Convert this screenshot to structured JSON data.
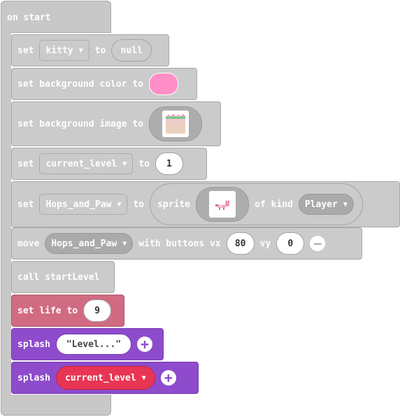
{
  "hat": {
    "label": "on start"
  },
  "blocks": {
    "set_kitty": {
      "kw_set": "set",
      "var": "kitty",
      "kw_to": "to",
      "value": "null"
    },
    "bg_color": {
      "label": "set background color to",
      "color": "#ff8fc6"
    },
    "bg_image": {
      "label": "set background image to"
    },
    "set_level": {
      "kw_set": "set",
      "var": "current_level",
      "kw_to": "to",
      "value": "1"
    },
    "set_sprite": {
      "kw_set": "set",
      "var": "Hops_and_Paw",
      "kw_to": "to",
      "kw_sprite": "sprite",
      "kw_kind": "of kind",
      "kind": "Player"
    },
    "move": {
      "kw_move": "move",
      "var": "Hops_and_Paw",
      "kw_with": "with buttons vx",
      "vx": "80",
      "kw_vy": "vy",
      "vy": "0"
    },
    "call": {
      "label": "call startLevel"
    },
    "life": {
      "label": "set life to",
      "value": "9"
    },
    "splash1": {
      "kw": "splash",
      "text": "\"Level...\""
    },
    "splash2": {
      "kw": "splash",
      "var": "current_level"
    }
  },
  "colors": {
    "looks": "#8e4ccc",
    "info": "#d06b82",
    "variables": "#e83553",
    "neutral": "#cbcbcb"
  }
}
